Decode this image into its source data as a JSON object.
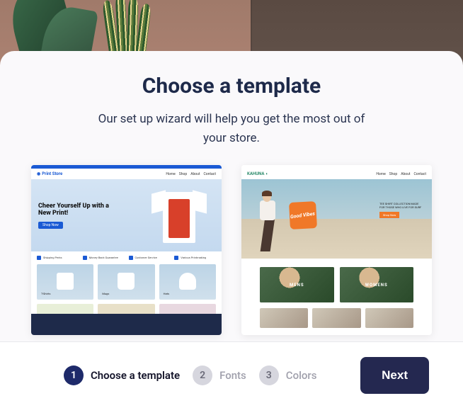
{
  "header": {
    "title": "Choose a template",
    "subtitle": "Our set up wizard will help you get the most out of your store."
  },
  "templates": [
    {
      "accent": "#1a5ad4",
      "logo": "Print Store",
      "nav": [
        "Home",
        "Shop",
        "About",
        "Contact"
      ],
      "hero_headline": "Cheer Yourself Up with a New Print!",
      "hero_cta": "Shop Now",
      "features": [
        "Shipping Perks",
        "Money Back Guarantee",
        "Customer Service",
        "Various Printmaking"
      ],
      "products": [
        {
          "label": "T-Shirts"
        },
        {
          "label": "Mugs"
        },
        {
          "label": "Hats"
        }
      ]
    },
    {
      "accent": "#2a8a6a",
      "logo": "KAHUNA",
      "nav": [
        "Home",
        "Shop",
        "About",
        "Contact"
      ],
      "badge": "Good Vibes",
      "hero_copy": "TEE SHIRT COLLECTION MADE FOR THOSE WHO LIVE FOR SURF",
      "hero_cta": "Shop Now",
      "categories": [
        "MENS",
        "WOMENS"
      ]
    }
  ],
  "stepper": {
    "steps": [
      {
        "num": "1",
        "label": "Choose a template",
        "active": true
      },
      {
        "num": "2",
        "label": "Fonts",
        "active": false
      },
      {
        "num": "3",
        "label": "Colors",
        "active": false
      }
    ],
    "next_label": "Next"
  }
}
